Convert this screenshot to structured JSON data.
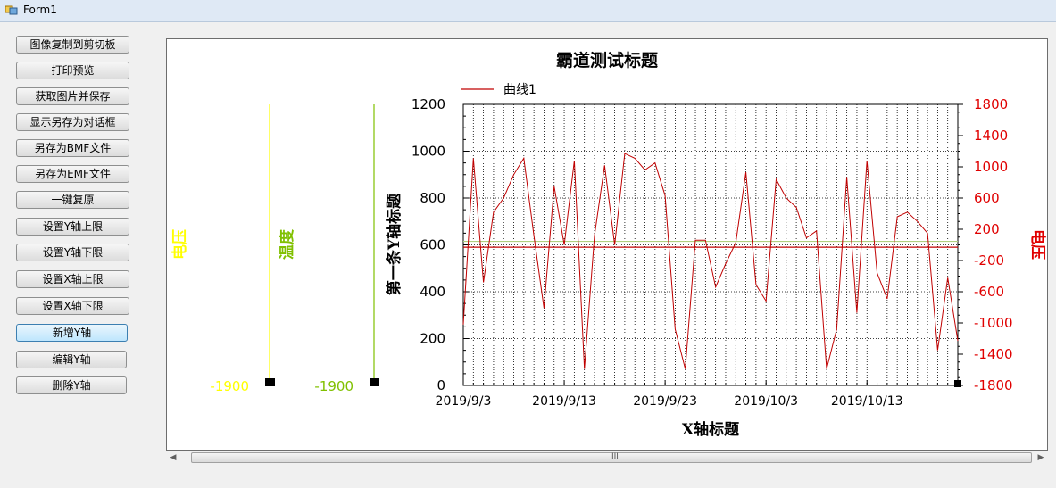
{
  "window": {
    "title": "Form1"
  },
  "buttons": [
    {
      "label": "图像复制到剪切板"
    },
    {
      "label": "打印预览"
    },
    {
      "label": "获取图片并保存"
    },
    {
      "label": "显示另存为对话框"
    },
    {
      "label": "另存为BMF文件"
    },
    {
      "label": "另存为EMF文件"
    },
    {
      "label": "一键复原"
    },
    {
      "label": "设置Y轴上限"
    },
    {
      "label": "设置Y轴下限"
    },
    {
      "label": "设置X轴上限"
    },
    {
      "label": "设置X轴下限"
    },
    {
      "label": "新增Y轴"
    },
    {
      "label": "编辑Y轴"
    },
    {
      "label": "删除Y轴"
    }
  ],
  "scrollbar": {
    "grip": "III"
  },
  "chart_data": {
    "type": "line",
    "title": "霸道测试标题",
    "xlabel": "X轴标题",
    "ylabel": "第一条Y轴标题",
    "y2label": "电压",
    "ylim": [
      0,
      1200
    ],
    "y2lim": [
      -1800,
      1800
    ],
    "yticks": [
      0,
      200,
      400,
      600,
      800,
      1000,
      1200
    ],
    "y2ticks": [
      -1800,
      -1400,
      -1000,
      -600,
      -200,
      200,
      600,
      1000,
      1400,
      1800
    ],
    "x_tick_labels": [
      "2019/9/3",
      "2019/9/13",
      "2019/9/23",
      "2019/10/3",
      "2019/10/13"
    ],
    "grid": true,
    "legend_position": "top-left",
    "colors": {
      "series": "#c00000",
      "voltage_axis": "#ffff00",
      "temperature_axis": "#80c000",
      "y2_axis": "#e00000",
      "h_line_green": "#b0d080"
    },
    "extra_axes": [
      {
        "label": "电压",
        "min_label": "-1900",
        "color": "#ffff00"
      },
      {
        "label": "温度",
        "min_label": "-1900",
        "color": "#80c000"
      }
    ],
    "series": [
      {
        "name": "曲线1",
        "color": "#c00000",
        "x": [
          "2019/9/3",
          "2019/9/4",
          "2019/9/5",
          "2019/9/6",
          "2019/9/7",
          "2019/9/8",
          "2019/9/9",
          "2019/9/10",
          "2019/9/11",
          "2019/9/12",
          "2019/9/13",
          "2019/9/14",
          "2019/9/15",
          "2019/9/16",
          "2019/9/17",
          "2019/9/18",
          "2019/9/19",
          "2019/9/20",
          "2019/9/21",
          "2019/9/22",
          "2019/9/23",
          "2019/9/24",
          "2019/9/25",
          "2019/9/26",
          "2019/9/27",
          "2019/9/28",
          "2019/9/29",
          "2019/9/30",
          "2019/10/1",
          "2019/10/2",
          "2019/10/3",
          "2019/10/4",
          "2019/10/5",
          "2019/10/6",
          "2019/10/7",
          "2019/10/8",
          "2019/10/9",
          "2019/10/10",
          "2019/10/11",
          "2019/10/12",
          "2019/10/13",
          "2019/10/14",
          "2019/10/15",
          "2019/10/16",
          "2019/10/17",
          "2019/10/18",
          "2019/10/19",
          "2019/10/20",
          "2019/10/21",
          "2019/10/22"
        ],
        "values": [
          260,
          970,
          440,
          740,
          800,
          900,
          970,
          640,
          330,
          850,
          600,
          960,
          70,
          640,
          940,
          600,
          990,
          970,
          920,
          950,
          810,
          240,
          70,
          620,
          620,
          420,
          520,
          610,
          910,
          430,
          360,
          880,
          800,
          760,
          630,
          660,
          70,
          240,
          890,
          310,
          960,
          480,
          370,
          720,
          740,
          700,
          650,
          150,
          460,
          190
        ]
      }
    ],
    "h_lines": [
      {
        "value": 615,
        "color": "#b0d080"
      },
      {
        "value": 590,
        "color": "#c00000"
      }
    ]
  }
}
